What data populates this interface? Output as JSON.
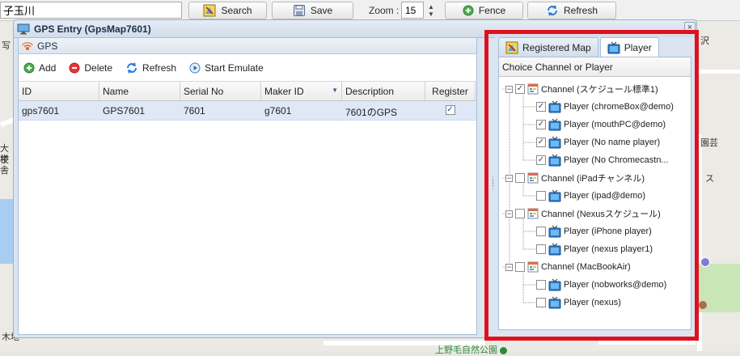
{
  "toolbar": {
    "search_value": "子玉川",
    "search_label": "Search",
    "save_label": "Save",
    "zoom_label": "Zoom :",
    "zoom_value": "15",
    "fence_label": "Fence",
    "refresh_label": "Refresh"
  },
  "map": {
    "fragments": [
      "写",
      "大学",
      "校舎",
      "沢",
      "園芸",
      "ス",
      "木地"
    ],
    "park_label": "上野毛自然公園"
  },
  "window": {
    "title": "GPS Entry (GpsMap7601)"
  },
  "gps_panel": {
    "title": "GPS",
    "toolbar": {
      "add": "Add",
      "delete": "Delete",
      "refresh": "Refresh",
      "start_emulate": "Start Emulate"
    },
    "columns": [
      "ID",
      "Name",
      "Serial No",
      "Maker ID",
      "Description",
      "Register"
    ],
    "rows": [
      {
        "id": "gps7601",
        "name": "GPS7601",
        "serial": "7601",
        "maker": "g7601",
        "description": "7601のGPS",
        "register": true
      }
    ]
  },
  "right_panel": {
    "tabs": [
      "Registered Map",
      "Player"
    ],
    "active_tab": "Player",
    "tree_header": "Choice Channel or Player",
    "tree": [
      {
        "label": "Channel (スケジュール標準1)",
        "checked": true,
        "players": [
          {
            "label": "Player (chromeBox@demo)",
            "checked": true
          },
          {
            "label": "Player (mouthPC@demo)",
            "checked": true
          },
          {
            "label": "Player (No name player)",
            "checked": true
          },
          {
            "label": "Player (No Chromecastn...",
            "checked": true
          }
        ]
      },
      {
        "label": "Channel (iPadチャンネル)",
        "checked": false,
        "players": [
          {
            "label": "Player (ipad@demo)",
            "checked": false
          }
        ]
      },
      {
        "label": "Channel (Nexusスケジュール)",
        "checked": false,
        "players": [
          {
            "label": "Player (iPhone player)",
            "checked": false
          },
          {
            "label": "Player (nexus player1)",
            "checked": false
          }
        ]
      },
      {
        "label": "Channel (MacBookAir)",
        "checked": false,
        "players": [
          {
            "label": "Player (nobworks@demo)",
            "checked": false
          },
          {
            "label": "Player (nexus)",
            "checked": false
          }
        ]
      }
    ]
  },
  "colors": {
    "highlight_border": "#e0101d",
    "selected_row": "#dfe8f6",
    "window_frame": "#dbe5f1"
  }
}
